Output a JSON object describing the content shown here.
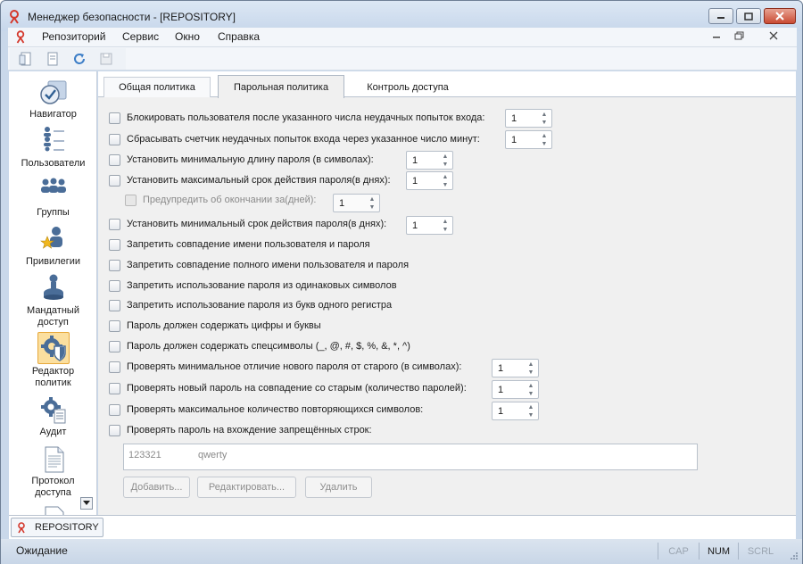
{
  "window": {
    "title": "Менеджер безопасности - [REPOSITORY]"
  },
  "menu": {
    "items": [
      "Репозиторий",
      "Сервис",
      "Окно",
      "Справка"
    ]
  },
  "toolbar": {
    "buttons": [
      "new-document-icon",
      "copy-document-icon",
      "refresh-icon",
      "save-icon"
    ]
  },
  "nav": {
    "items": [
      {
        "label": "Навигатор",
        "icon": "navigator-icon"
      },
      {
        "label": "Пользователи",
        "icon": "users-icon"
      },
      {
        "label": "Группы",
        "icon": "groups-icon"
      },
      {
        "label": "Привилегии",
        "icon": "privileges-icon"
      },
      {
        "label": "Мандатный доступ",
        "label_l1": "Мандатный",
        "label_l2": "доступ",
        "icon": "mandatory-access-icon"
      },
      {
        "label": "Редактор политик",
        "label_l1": "Редактор",
        "label_l2": "политик",
        "icon": "policy-editor-icon",
        "selected": true
      },
      {
        "label": "Аудит",
        "icon": "audit-icon"
      },
      {
        "label": "Протокол доступа",
        "label_l1": "Протокол",
        "label_l2": "доступа",
        "icon": "access-log-icon"
      }
    ]
  },
  "tabs": [
    {
      "label": "Общая политика",
      "active": false
    },
    {
      "label": "Парольная политика",
      "active": true
    },
    {
      "label": "Контроль доступа",
      "active": false
    }
  ],
  "policy": {
    "rows": [
      {
        "label": "Блокировать пользователя после указанного числа неудачных попыток входа:",
        "checked": false,
        "value": "1"
      },
      {
        "label": "Сбрасывать счетчик неудачных попыток входа через указанное число минут:",
        "checked": false,
        "value": "1"
      },
      {
        "label": "Установить минимальную длину пароля (в символах):",
        "checked": false,
        "value": "1"
      },
      {
        "label": "Установить максимальный срок действия пароля(в днях):",
        "checked": false,
        "value": "1"
      },
      {
        "label": "Предупредить об окончании за(дней):",
        "checked": false,
        "value": "1",
        "disabled": true
      },
      {
        "label": "Установить минимальный срок действия пароля(в днях):",
        "checked": false,
        "value": "1"
      },
      {
        "label": "Запретить совпадение имени пользователя и пароля",
        "checked": false
      },
      {
        "label": "Запретить совпадение полного имени пользователя и пароля",
        "checked": false
      },
      {
        "label": "Запретить использование пароля из одинаковых символов",
        "checked": false
      },
      {
        "label": "Запретить использование пароля из букв одного регистра",
        "checked": false
      },
      {
        "label": "Пароль должен содержать цифры и буквы",
        "checked": false
      },
      {
        "label": "Пароль должен содержать спецсимволы (_, @, #, $, %, &, *, ^)",
        "checked": false
      },
      {
        "label": "Проверять минимальное отличие нового пароля от старого (в символах):",
        "checked": false,
        "value": "1"
      },
      {
        "label": "Проверять новый пароль на совпадение со старым (количество паролей):",
        "checked": false,
        "value": "1"
      },
      {
        "label": "Проверять максимальное количество повторяющихся символов:",
        "checked": false,
        "value": "1"
      },
      {
        "label": "Проверять пароль на вхождение запрещённых строк:",
        "checked": false
      }
    ],
    "forbidden_strings": [
      "123321",
      "qwerty"
    ],
    "buttons": {
      "add": "Добавить...",
      "edit": "Редактировать...",
      "delete": "Удалить"
    }
  },
  "doc_tabs": [
    {
      "label": "REPOSITORY"
    }
  ],
  "status": {
    "text": "Ожидание",
    "indicators": [
      {
        "label": "CAP",
        "active": false
      },
      {
        "label": "NUM",
        "active": true
      },
      {
        "label": "SCRL",
        "active": false
      }
    ]
  },
  "colors": {
    "accent_selected": "#fbdf9f",
    "frame": "#c9d8ea"
  }
}
